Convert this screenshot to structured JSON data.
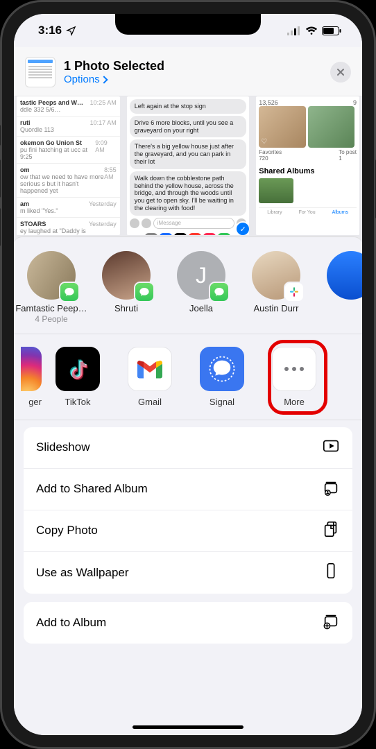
{
  "status": {
    "time": "3:16",
    "location_icon": "location-arrow"
  },
  "header": {
    "title": "1 Photo Selected",
    "options_label": "Options"
  },
  "background_stats": {
    "count1": "13,526",
    "count2": "9",
    "fav_label": "Favorites",
    "fav_count": "720",
    "topost_label": "To post",
    "topost_count": "1",
    "shared_label": "Shared Albums"
  },
  "bg_chat_rows": [
    {
      "title": "tastic Peeps and W…",
      "sub": "ddle 332 5/6…",
      "time": "10:25 AM"
    },
    {
      "title": "ruti",
      "sub": "Quordle 113",
      "time": "10:17 AM"
    },
    {
      "title": "okemon Go Union St",
      "sub": "pu fini hatching at ucc at 9:25",
      "time": "9:09 AM"
    },
    {
      "title": "om",
      "sub": "ow that we need to have more serious s but it hasn't happened yet",
      "time": "8:55 AM"
    },
    {
      "title": "am",
      "sub": "m liked \"Yes.\"",
      "time": "Yesterday"
    },
    {
      "title": "STOARS",
      "sub": "ey laughed at \"Daddy is Why We Ca…",
      "time": "Yesterday"
    }
  ],
  "bg_messages": [
    "Left again at the stop sign",
    "Drive 6 more blocks, until you see a graveyard on your right",
    "There's a big yellow house just after the graveyard, and you can park in their lot",
    "Walk down the cobblestone path behind the yellow house, across the bridge, and through the woods until you get to open sky. I'll be waiting in the clearing with food!"
  ],
  "bg_compose_placeholder": "iMessage",
  "bg_tabs": {
    "t1": "Library",
    "t2": "For You",
    "t3": "Albums"
  },
  "contacts": [
    {
      "name": "Famtastic Peep…",
      "sub": "4 People",
      "badge": "messages",
      "avatar": "group"
    },
    {
      "name": "Shruti",
      "sub": "",
      "badge": "messages",
      "avatar": "woman"
    },
    {
      "name": "Joella",
      "sub": "",
      "badge": "messages",
      "avatar": "initial",
      "initial": "J"
    },
    {
      "name": "Austin Durr",
      "sub": "",
      "badge": "slack",
      "avatar": "man"
    },
    {
      "name": "",
      "sub": "",
      "badge": "",
      "avatar": "globe"
    }
  ],
  "apps": [
    {
      "name": "ger",
      "icon": "instagram",
      "partial": true
    },
    {
      "name": "TikTok",
      "icon": "tiktok"
    },
    {
      "name": "Gmail",
      "icon": "gmail"
    },
    {
      "name": "Signal",
      "icon": "signal"
    },
    {
      "name": "More",
      "icon": "more",
      "highlighted": true
    }
  ],
  "actions": [
    {
      "label": "Slideshow",
      "icon": "play-rect"
    },
    {
      "label": "Add to Shared Album",
      "icon": "album-person"
    },
    {
      "label": "Copy Photo",
      "icon": "doc-dup"
    },
    {
      "label": "Use as Wallpaper",
      "icon": "phone-rect"
    }
  ],
  "actions2": [
    {
      "label": "Add to Album",
      "icon": "album-plus"
    }
  ]
}
